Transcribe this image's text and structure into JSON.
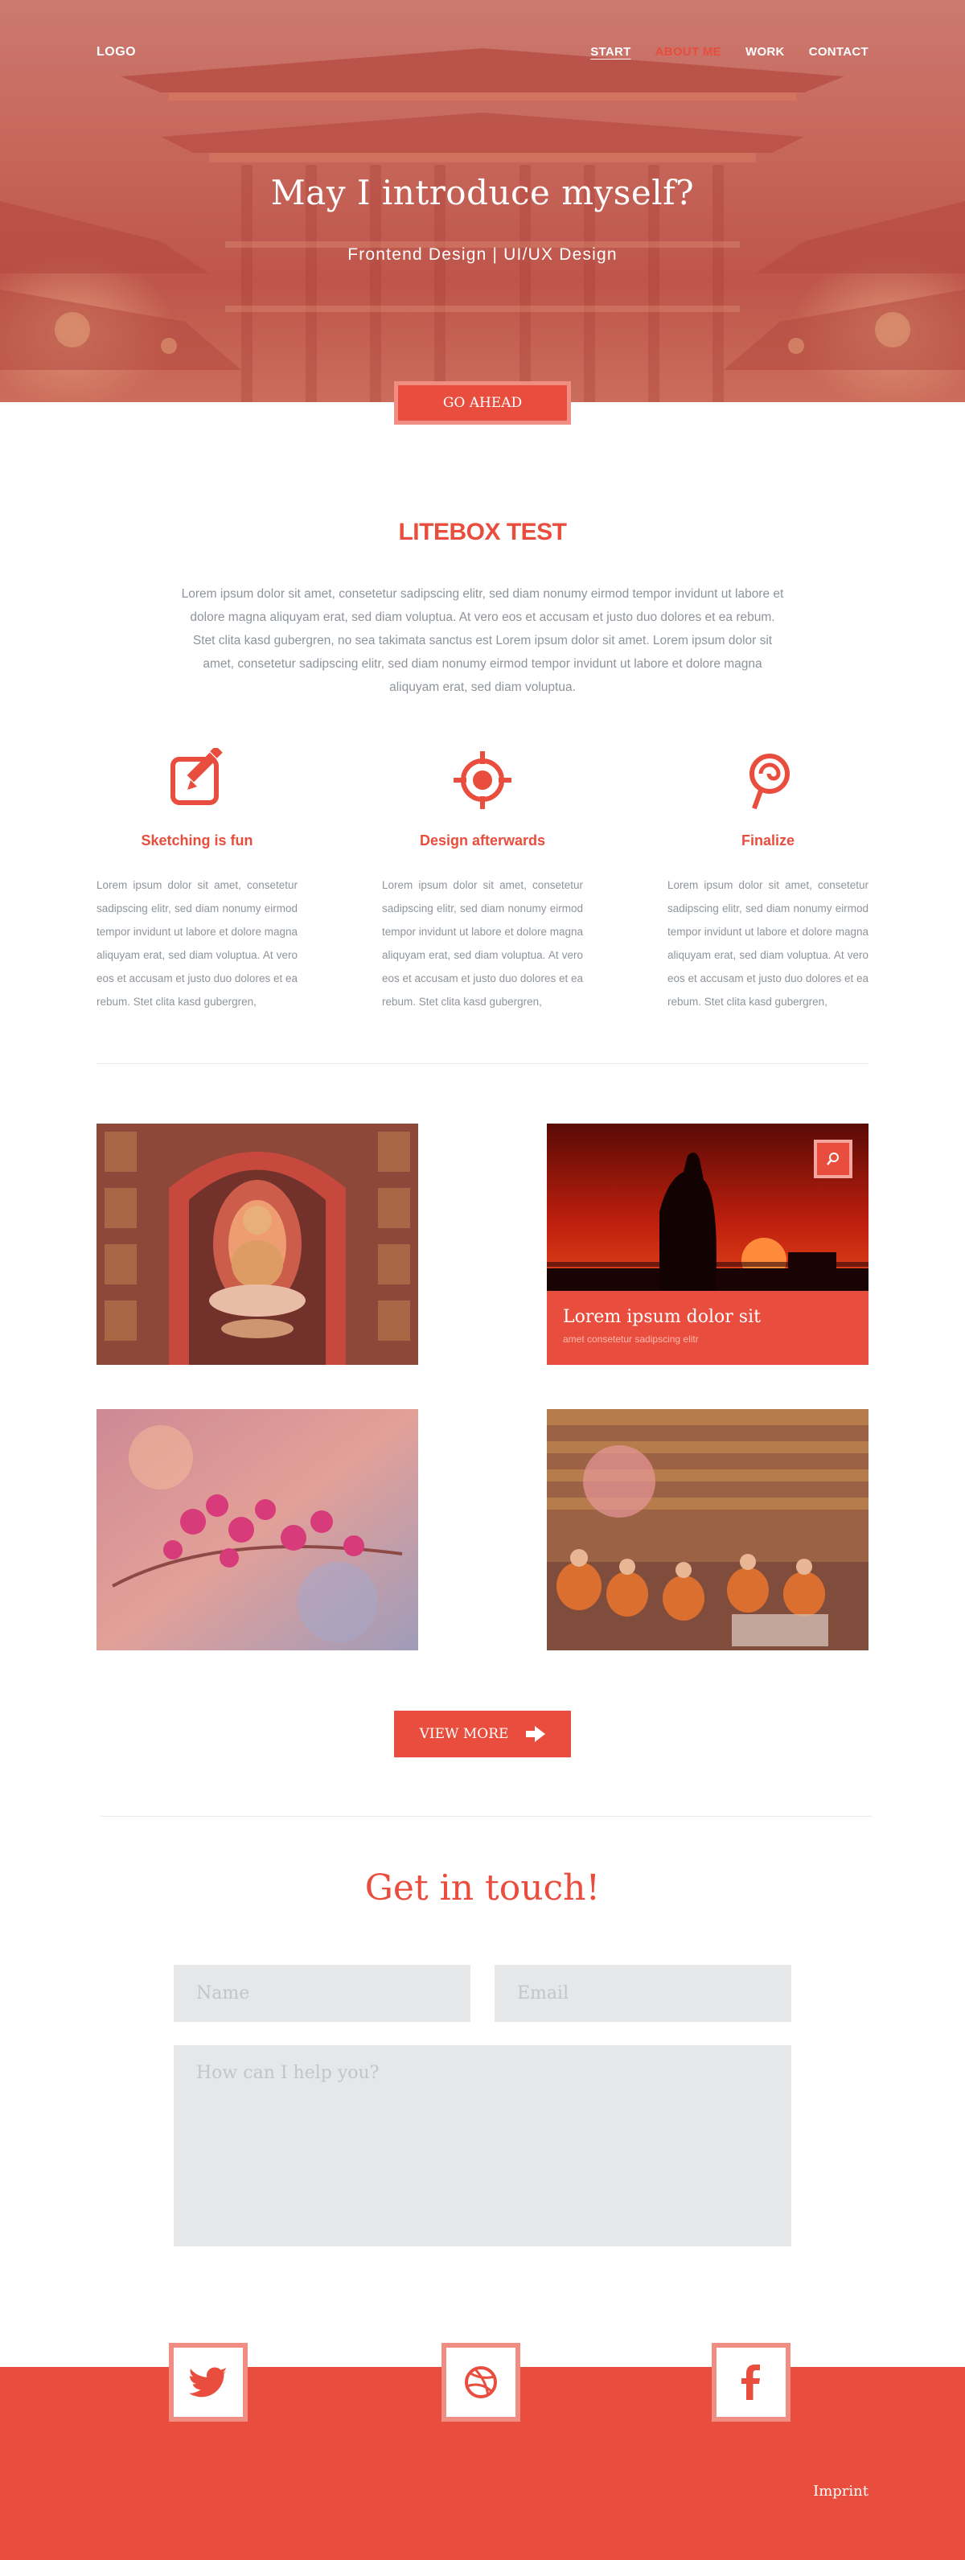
{
  "nav": {
    "logo": "LOGO",
    "links": [
      "START",
      "ABOUT ME",
      "WORK",
      "CONTACT"
    ]
  },
  "hero": {
    "title": "May I introduce myself?",
    "subtitle": "Frontend Design | UI/UX Design",
    "button": "GO AHEAD"
  },
  "litebox": {
    "title": "LITEBOX TEST",
    "intro": "Lorem ipsum dolor sit amet, consetetur sadipscing elitr, sed diam nonumy eirmod tempor invidunt ut labore et dolore magna aliquyam erat, sed diam voluptua. At vero eos et accusam et justo duo dolores et ea rebum. Stet clita kasd gubergren, no sea takimata sanctus est Lorem ipsum dolor sit amet. Lorem ipsum dolor sit amet, consetetur sadipscing elitr, sed diam nonumy eirmod tempor invidunt ut labore et dolore magna aliquyam erat, sed diam voluptua.",
    "features": [
      {
        "icon": "edit-icon",
        "title": "Sketching is fun",
        "text": "Lorem ipsum dolor sit amet, consetetur sadipscing elitr, sed diam nonumy eirmod tempor invidunt ut labore et dolore magna aliquyam erat, sed diam voluptua. At vero eos et accusam et justo duo dolores et ea rebum. Stet clita kasd gubergren,"
      },
      {
        "icon": "target-icon",
        "title": "Design afterwards",
        "text": "Lorem ipsum dolor sit amet, consetetur sadipscing elitr, sed diam nonumy eirmod tempor invidunt ut labore et dolore magna aliquyam erat, sed diam voluptua. At vero eos et accusam et justo duo dolores et ea rebum. Stet clita kasd gubergren,"
      },
      {
        "icon": "lollipop-icon",
        "title": "Finalize",
        "text": "Lorem ipsum dolor sit amet, consetetur sadipscing elitr, sed diam nonumy eirmod tempor invidunt ut labore et dolore magna aliquyam erat, sed diam voluptua. At vero eos et accusam et justo duo dolores et ea rebum. Stet clita kasd gubergren,"
      }
    ]
  },
  "gallery": {
    "caption_title": "Lorem ipsum dolor sit",
    "caption_sub": "amet consetetur sadipscing elitr",
    "button": "VIEW MORE"
  },
  "contact": {
    "title": "Get in touch!",
    "name_placeholder": "Name",
    "email_placeholder": "Email",
    "message_placeholder": "How can I help you?"
  },
  "footer": {
    "social": [
      "twitter-icon",
      "dribbble-icon",
      "facebook-icon"
    ],
    "imprint": "Imprint"
  },
  "colors": {
    "accent": "#e84d3d",
    "accent_light": "#f08e84",
    "field_bg": "#e5e7e8",
    "body_text": "#8e949a"
  }
}
